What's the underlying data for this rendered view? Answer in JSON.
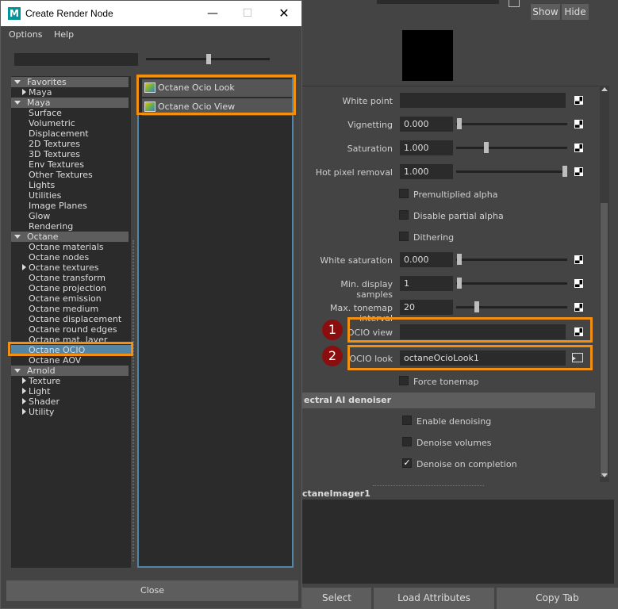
{
  "dialog": {
    "title": "Create Render Node",
    "app_logo": "M",
    "menu": [
      "Options",
      "Help"
    ],
    "close_label": "Close",
    "tree": {
      "favorites": {
        "label": "Favorites",
        "items": [
          "Maya"
        ]
      },
      "maya": {
        "label": "Maya",
        "items": [
          "Surface",
          "Volumetric",
          "Displacement",
          "2D Textures",
          "3D Textures",
          "Env Textures",
          "Other Textures",
          "Lights",
          "Utilities",
          "Image Planes",
          "Glow",
          "Rendering"
        ]
      },
      "octane": {
        "label": "Octane",
        "items": [
          "Octane materials",
          "Octane nodes",
          "Octane textures",
          "Octane transform",
          "Octane projection",
          "Octane emission",
          "Octane medium",
          "Octane displacement",
          "Octane round edges",
          "Octane mat. layer",
          "Octane OCIO",
          "Octane AOV"
        ],
        "selected": "Octane OCIO"
      },
      "arnold": {
        "label": "Arnold",
        "items": [
          "Texture",
          "Light",
          "Shader",
          "Utility"
        ]
      }
    },
    "nodes": [
      "Octane Ocio Look",
      "Octane Ocio View"
    ]
  },
  "editor": {
    "show_label": "Show",
    "hide_label": "Hide",
    "attributes": {
      "white_point": {
        "label": "White point",
        "value": ""
      },
      "vignetting": {
        "label": "Vignetting",
        "value": "0.000",
        "slider": 0.0
      },
      "saturation": {
        "label": "Saturation",
        "value": "1.000",
        "slider": 0.25
      },
      "hot_pixel": {
        "label": "Hot pixel removal",
        "value": "1.000",
        "slider": 1.0
      },
      "premultiplied": {
        "label": "Premultiplied alpha",
        "checked": false
      },
      "disable_partial": {
        "label": "Disable partial alpha",
        "checked": false
      },
      "dithering": {
        "label": "Dithering",
        "checked": false
      },
      "white_saturation": {
        "label": "White saturation",
        "value": "0.000",
        "slider": 0.0
      },
      "min_display": {
        "label": "Min. display samples",
        "value": "1",
        "slider": 0.0
      },
      "max_tonemap": {
        "label": "Max. tonemap interval",
        "value": "20",
        "slider": 0.18
      },
      "ocio_view": {
        "label": "OCIO view",
        "value": ""
      },
      "ocio_look": {
        "label": "OCIO look",
        "value": "octaneOcioLook1"
      },
      "force_tonemap": {
        "label": "Force tonemap",
        "checked": false
      }
    },
    "denoiser_section": "ectral AI denoiser",
    "denoiser": {
      "enable": {
        "label": "Enable denoising",
        "checked": false
      },
      "volumes": {
        "label": "Denoise volumes",
        "checked": false
      },
      "on_completion": {
        "label": "Denoise on completion",
        "checked": true
      }
    },
    "node_name": "ctaneImager1",
    "bottom": {
      "select": "Select",
      "load": "Load Attributes",
      "copy": "Copy Tab"
    },
    "badges": [
      "1",
      "2"
    ]
  },
  "colors": {
    "highlight": "#f29111",
    "selection": "#5285a6",
    "badge": "#8a0e0e"
  }
}
